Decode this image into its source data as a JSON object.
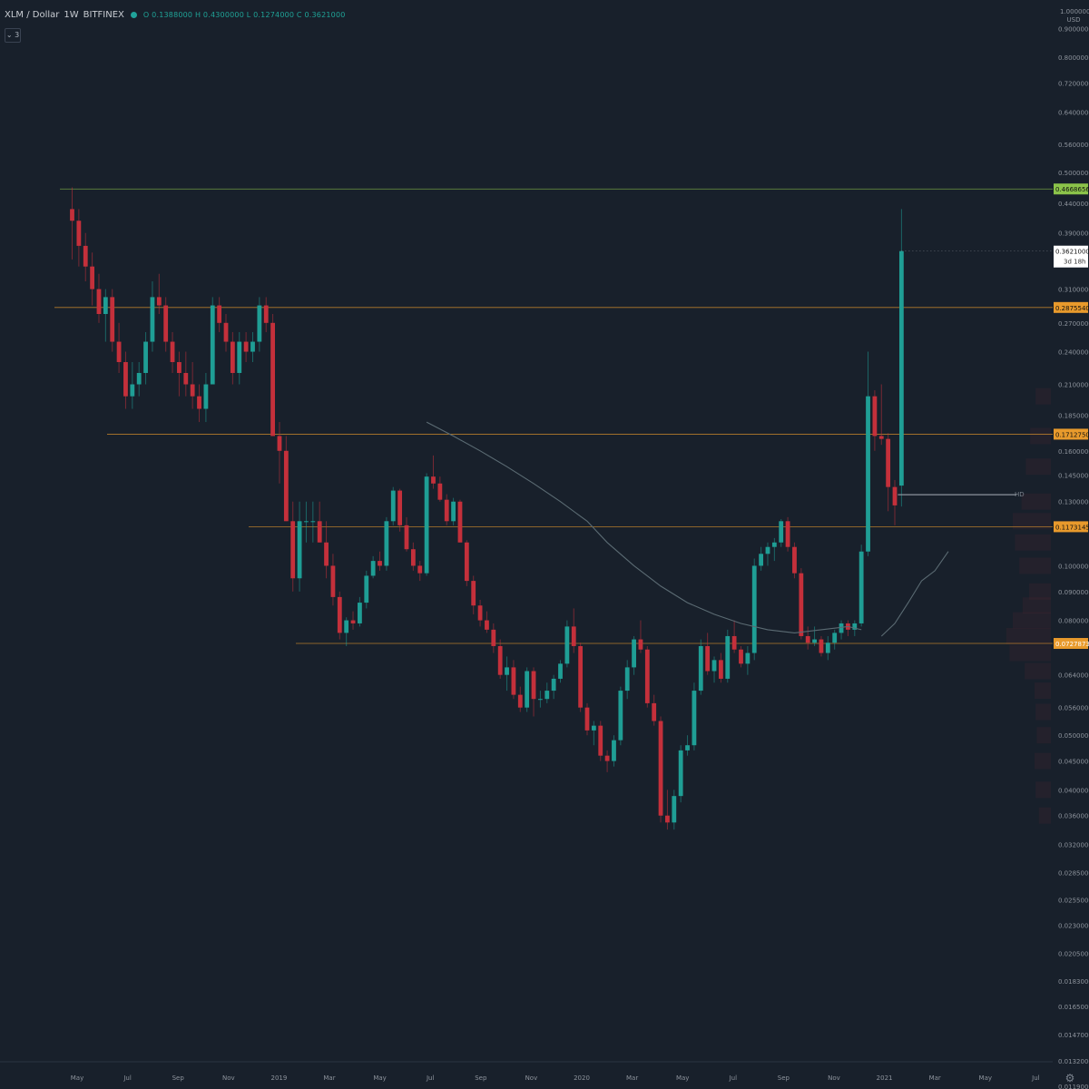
{
  "header": {
    "symbol": "XLM / Dollar",
    "interval": "1W",
    "exchange": "BITFINEX",
    "ohlc": "O 0.1388000 H 0.4300000 L 0.1274000 C 0.3621000"
  },
  "collapse_label": "⌄ 3",
  "price_axis": {
    "top_value": "1.0000000",
    "currency": "USD",
    "labels": [
      "0.9000000",
      "0.8000000",
      "0.7200000",
      "0.6400000",
      "0.5600000",
      "0.5000000",
      "0.4400000",
      "0.3900000",
      "0.3100000",
      "0.2700000",
      "0.2400000",
      "0.2100000",
      "0.1850000",
      "0.1600000",
      "0.1450000",
      "0.1300000",
      "0.1000000",
      "0.0900000",
      "0.0800000",
      "0.0640000",
      "0.0560000",
      "0.0500000",
      "0.0450000",
      "0.0400000",
      "0.0360000",
      "0.0320000",
      "0.0285000",
      "0.0255000",
      "0.0230000",
      "0.0205000",
      "0.0183000",
      "0.0165000",
      "0.0147000",
      "0.0132000",
      "0.0119000"
    ]
  },
  "levels": [
    {
      "value": "0.46686565",
      "color": "#8bc34a",
      "text_color": "#111111"
    },
    {
      "value": "0.28755402",
      "color": "#e89a2c",
      "text_color": "#111111"
    },
    {
      "value": "0.17127509",
      "color": "#e89a2c",
      "text_color": "#111111"
    },
    {
      "value": "0.11731454",
      "color": "#e89a2c",
      "text_color": "#111111"
    },
    {
      "value": "0.07278732",
      "color": "#e89a2c",
      "text_color": "#ffffff"
    }
  ],
  "last_price": {
    "value": "0.3621000",
    "countdown": "3d 18h"
  },
  "hd_label": "HD",
  "time_axis": [
    "May",
    "Jul",
    "Sep",
    "Nov",
    "2019",
    "Mar",
    "May",
    "Jul",
    "Sep",
    "Nov",
    "2020",
    "Mar",
    "May",
    "Jul",
    "Sep",
    "Nov",
    "2021",
    "Mar",
    "May",
    "Jul"
  ],
  "colors": {
    "up": "#1f9e95",
    "down": "#c4303b",
    "background": "#18202b",
    "ma": "#5b6b73"
  },
  "chart_data": {
    "type": "candlestick",
    "series": [
      {
        "name": "XLM / Dollar",
        "x": [],
        "values": []
      }
    ],
    "log_scale": true,
    "ylim": [
      0.0119,
      1.0
    ],
    "ohlc": [
      [
        0.43,
        0.47,
        0.35,
        0.41
      ],
      [
        0.41,
        0.43,
        0.34,
        0.37
      ],
      [
        0.37,
        0.39,
        0.32,
        0.34
      ],
      [
        0.34,
        0.36,
        0.29,
        0.31
      ],
      [
        0.31,
        0.33,
        0.27,
        0.28
      ],
      [
        0.28,
        0.31,
        0.25,
        0.3
      ],
      [
        0.3,
        0.31,
        0.24,
        0.25
      ],
      [
        0.25,
        0.27,
        0.22,
        0.23
      ],
      [
        0.23,
        0.24,
        0.19,
        0.2
      ],
      [
        0.2,
        0.23,
        0.19,
        0.21
      ],
      [
        0.21,
        0.23,
        0.2,
        0.22
      ],
      [
        0.22,
        0.26,
        0.21,
        0.25
      ],
      [
        0.25,
        0.32,
        0.24,
        0.3
      ],
      [
        0.3,
        0.33,
        0.28,
        0.29
      ],
      [
        0.29,
        0.3,
        0.24,
        0.25
      ],
      [
        0.25,
        0.26,
        0.22,
        0.23
      ],
      [
        0.23,
        0.24,
        0.2,
        0.22
      ],
      [
        0.22,
        0.24,
        0.2,
        0.21
      ],
      [
        0.21,
        0.23,
        0.19,
        0.2
      ],
      [
        0.2,
        0.21,
        0.18,
        0.19
      ],
      [
        0.19,
        0.22,
        0.18,
        0.21
      ],
      [
        0.21,
        0.3,
        0.21,
        0.29
      ],
      [
        0.29,
        0.3,
        0.26,
        0.27
      ],
      [
        0.27,
        0.28,
        0.24,
        0.25
      ],
      [
        0.25,
        0.26,
        0.21,
        0.22
      ],
      [
        0.22,
        0.26,
        0.21,
        0.25
      ],
      [
        0.25,
        0.26,
        0.23,
        0.24
      ],
      [
        0.24,
        0.26,
        0.23,
        0.25
      ],
      [
        0.25,
        0.3,
        0.24,
        0.29
      ],
      [
        0.29,
        0.3,
        0.26,
        0.27
      ],
      [
        0.27,
        0.28,
        0.17,
        0.17
      ],
      [
        0.17,
        0.18,
        0.14,
        0.16
      ],
      [
        0.16,
        0.17,
        0.12,
        0.12
      ],
      [
        0.12,
        0.13,
        0.09,
        0.095
      ],
      [
        0.095,
        0.13,
        0.09,
        0.12
      ],
      [
        0.12,
        0.13,
        0.11,
        0.12
      ],
      [
        0.12,
        0.13,
        0.11,
        0.12
      ],
      [
        0.12,
        0.13,
        0.11,
        0.11
      ],
      [
        0.11,
        0.12,
        0.095,
        0.1
      ],
      [
        0.1,
        0.105,
        0.085,
        0.088
      ],
      [
        0.088,
        0.09,
        0.074,
        0.076
      ],
      [
        0.076,
        0.081,
        0.072,
        0.08
      ],
      [
        0.08,
        0.083,
        0.077,
        0.079
      ],
      [
        0.079,
        0.088,
        0.078,
        0.086
      ],
      [
        0.086,
        0.098,
        0.084,
        0.096
      ],
      [
        0.096,
        0.104,
        0.095,
        0.102
      ],
      [
        0.102,
        0.106,
        0.098,
        0.1
      ],
      [
        0.1,
        0.122,
        0.098,
        0.12
      ],
      [
        0.12,
        0.138,
        0.118,
        0.136
      ],
      [
        0.136,
        0.137,
        0.115,
        0.118
      ],
      [
        0.118,
        0.122,
        0.106,
        0.107
      ],
      [
        0.107,
        0.11,
        0.098,
        0.1
      ],
      [
        0.1,
        0.102,
        0.094,
        0.097
      ],
      [
        0.097,
        0.146,
        0.096,
        0.144
      ],
      [
        0.144,
        0.157,
        0.137,
        0.14
      ],
      [
        0.14,
        0.144,
        0.13,
        0.131
      ],
      [
        0.131,
        0.134,
        0.118,
        0.12
      ],
      [
        0.12,
        0.132,
        0.118,
        0.13
      ],
      [
        0.13,
        0.131,
        0.11,
        0.11
      ],
      [
        0.11,
        0.111,
        0.092,
        0.094
      ],
      [
        0.094,
        0.096,
        0.082,
        0.085
      ],
      [
        0.085,
        0.087,
        0.078,
        0.08
      ],
      [
        0.08,
        0.083,
        0.076,
        0.077
      ],
      [
        0.077,
        0.079,
        0.07,
        0.072
      ],
      [
        0.072,
        0.074,
        0.063,
        0.064
      ],
      [
        0.064,
        0.069,
        0.06,
        0.066
      ],
      [
        0.066,
        0.068,
        0.058,
        0.059
      ],
      [
        0.059,
        0.061,
        0.055,
        0.056
      ],
      [
        0.056,
        0.066,
        0.055,
        0.065
      ],
      [
        0.065,
        0.066,
        0.054,
        0.058
      ],
      [
        0.058,
        0.06,
        0.056,
        0.058
      ],
      [
        0.058,
        0.062,
        0.057,
        0.06
      ],
      [
        0.06,
        0.064,
        0.058,
        0.063
      ],
      [
        0.063,
        0.068,
        0.062,
        0.067
      ],
      [
        0.067,
        0.08,
        0.066,
        0.078
      ],
      [
        0.078,
        0.084,
        0.07,
        0.072
      ],
      [
        0.072,
        0.073,
        0.055,
        0.056
      ],
      [
        0.056,
        0.057,
        0.05,
        0.051
      ],
      [
        0.051,
        0.053,
        0.048,
        0.052
      ],
      [
        0.052,
        0.053,
        0.045,
        0.046
      ],
      [
        0.046,
        0.047,
        0.043,
        0.045
      ],
      [
        0.045,
        0.05,
        0.044,
        0.049
      ],
      [
        0.049,
        0.061,
        0.048,
        0.06
      ],
      [
        0.06,
        0.068,
        0.058,
        0.066
      ],
      [
        0.066,
        0.075,
        0.064,
        0.074
      ],
      [
        0.074,
        0.08,
        0.07,
        0.071
      ],
      [
        0.071,
        0.072,
        0.056,
        0.057
      ],
      [
        0.057,
        0.059,
        0.052,
        0.053
      ],
      [
        0.053,
        0.054,
        0.035,
        0.036
      ],
      [
        0.036,
        0.04,
        0.034,
        0.035
      ],
      [
        0.035,
        0.04,
        0.034,
        0.039
      ],
      [
        0.039,
        0.048,
        0.038,
        0.047
      ],
      [
        0.047,
        0.05,
        0.046,
        0.048
      ],
      [
        0.048,
        0.062,
        0.047,
        0.06
      ],
      [
        0.06,
        0.074,
        0.059,
        0.072
      ],
      [
        0.072,
        0.076,
        0.064,
        0.065
      ],
      [
        0.065,
        0.069,
        0.062,
        0.068
      ],
      [
        0.068,
        0.07,
        0.062,
        0.063
      ],
      [
        0.063,
        0.077,
        0.062,
        0.075
      ],
      [
        0.075,
        0.08,
        0.07,
        0.071
      ],
      [
        0.071,
        0.072,
        0.066,
        0.067
      ],
      [
        0.067,
        0.072,
        0.064,
        0.07
      ],
      [
        0.07,
        0.103,
        0.068,
        0.1
      ],
      [
        0.1,
        0.108,
        0.098,
        0.105
      ],
      [
        0.105,
        0.11,
        0.1,
        0.108
      ],
      [
        0.108,
        0.112,
        0.102,
        0.11
      ],
      [
        0.11,
        0.121,
        0.108,
        0.12
      ],
      [
        0.12,
        0.122,
        0.106,
        0.108
      ],
      [
        0.108,
        0.11,
        0.095,
        0.097
      ],
      [
        0.097,
        0.099,
        0.074,
        0.075
      ],
      [
        0.075,
        0.078,
        0.071,
        0.073
      ],
      [
        0.073,
        0.078,
        0.072,
        0.074
      ],
      [
        0.074,
        0.075,
        0.069,
        0.07
      ],
      [
        0.07,
        0.075,
        0.068,
        0.073
      ],
      [
        0.073,
        0.077,
        0.071,
        0.076
      ],
      [
        0.076,
        0.08,
        0.074,
        0.079
      ],
      [
        0.079,
        0.08,
        0.075,
        0.077
      ],
      [
        0.077,
        0.08,
        0.075,
        0.079
      ],
      [
        0.079,
        0.109,
        0.078,
        0.106
      ],
      [
        0.106,
        0.24,
        0.104,
        0.2
      ],
      [
        0.2,
        0.205,
        0.16,
        0.17
      ],
      [
        0.17,
        0.21,
        0.164,
        0.168
      ],
      [
        0.168,
        0.172,
        0.125,
        0.138
      ],
      [
        0.138,
        0.142,
        0.118,
        0.128
      ],
      [
        0.1388,
        0.43,
        0.1274,
        0.3621
      ]
    ],
    "ma": [
      [
        0.18,
        53
      ],
      [
        0.17,
        57
      ],
      [
        0.16,
        61
      ],
      [
        0.15,
        65
      ],
      [
        0.14,
        69
      ],
      [
        0.13,
        73
      ],
      [
        0.12,
        77
      ],
      [
        0.11,
        80
      ],
      [
        0.1,
        84
      ],
      [
        0.092,
        88
      ],
      [
        0.086,
        92
      ],
      [
        0.082,
        96
      ],
      [
        0.079,
        100
      ],
      [
        0.077,
        104
      ],
      [
        0.076,
        108
      ],
      [
        0.077,
        112
      ],
      [
        0.078,
        116
      ],
      [
        0.077,
        118
      ]
    ],
    "ma2": [
      [
        0.075,
        121
      ],
      [
        0.079,
        123
      ],
      [
        0.086,
        125
      ],
      [
        0.094,
        127
      ],
      [
        0.098,
        129
      ],
      [
        0.106,
        131
      ]
    ]
  }
}
